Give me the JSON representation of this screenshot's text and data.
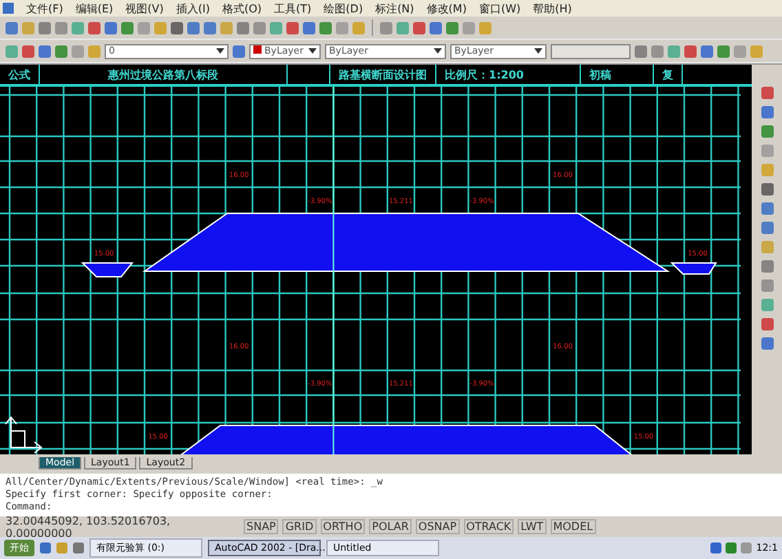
{
  "menu": [
    "文件(F)",
    "编辑(E)",
    "视图(V)",
    "插入(I)",
    "格式(O)",
    "工具(T)",
    "绘图(D)",
    "标注(N)",
    "修改(M)",
    "窗口(W)",
    "帮助(H)"
  ],
  "properties": {
    "layer": "0",
    "color_setting": "ByLayer",
    "linetype": "ByLayer",
    "lineweight": "ByLayer"
  },
  "drawing_header": [
    "公式",
    "惠州过境公路第八标段",
    "路基横断面设计图",
    "比例尺：1:200",
    "初稿",
    "复"
  ],
  "sections": [
    {
      "labels": [
        "16.00",
        "-3.90%",
        "15.211",
        "-3.90%",
        "16.00",
        "15.00",
        "15.00"
      ]
    },
    {
      "labels": [
        "16.00",
        "-3.90%",
        "15.211",
        "-3.90%",
        "16.00",
        "15.00",
        "15.00"
      ]
    }
  ],
  "tabs": [
    {
      "label": "Model",
      "selected": true
    },
    {
      "label": "Layout1",
      "selected": false
    },
    {
      "label": "Layout2",
      "selected": false
    }
  ],
  "command_lines": [
    "All/Center/Dynamic/Extents/Previous/Scale/Window] <real time>: _w",
    "Specify first corner: Specify opposite corner:"
  ],
  "command_prompt": "Command:",
  "coordinates": "32.00445092, 103.52016703, 0.00000000",
  "status_buttons": [
    "SNAP",
    "GRID",
    "ORTHO",
    "POLAR",
    "OSNAP",
    "OTRACK",
    "LWT",
    "MODEL"
  ],
  "taskbar": {
    "start": "开始",
    "tasks": [
      {
        "label": "有限元验算 (0:)",
        "selected": false
      },
      {
        "label": "AutoCAD 2002 - [Dra...",
        "selected": true
      },
      {
        "label": "Untitled",
        "selected": false
      }
    ],
    "clock": "12:1"
  }
}
